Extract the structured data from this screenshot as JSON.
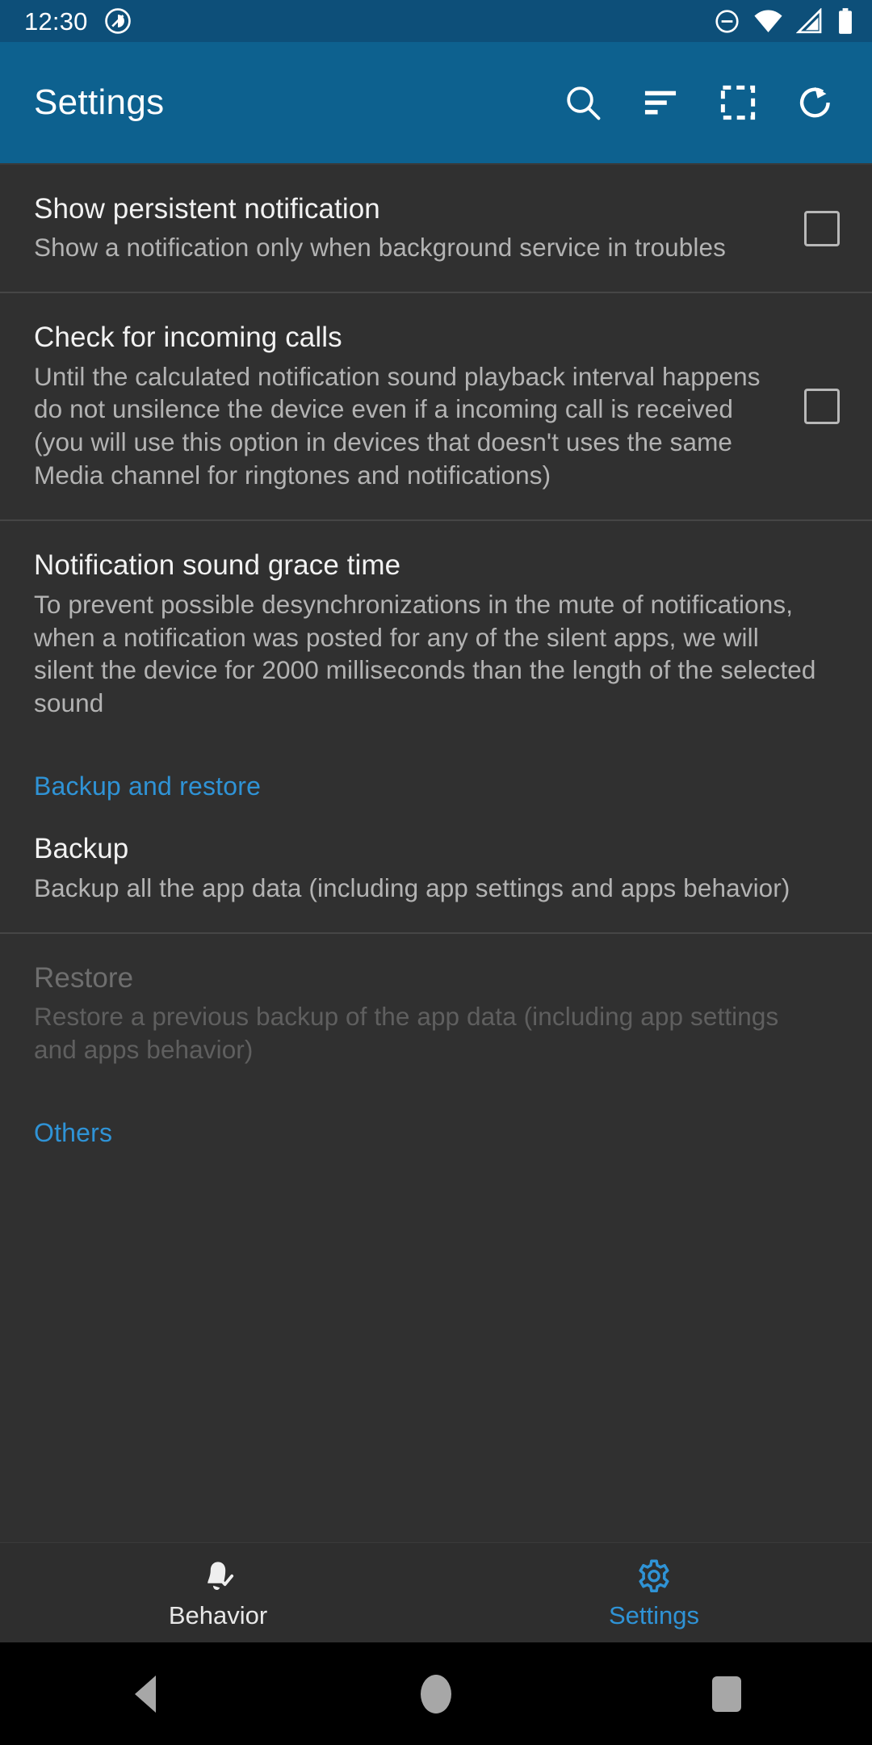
{
  "status_bar": {
    "time": "12:30",
    "icons": [
      "dnd-icon",
      "wifi-icon",
      "cellular-signal-icon",
      "battery-icon"
    ]
  },
  "app_bar": {
    "title": "Settings",
    "actions": [
      {
        "name": "search-icon",
        "label": "Search"
      },
      {
        "name": "sort-icon",
        "label": "Sort"
      },
      {
        "name": "select-all-icon",
        "label": "Select all"
      },
      {
        "name": "refresh-icon",
        "label": "Refresh"
      }
    ]
  },
  "preferences": [
    {
      "title": "Show persistent notification",
      "summary": "Show a notification only when background service in troubles",
      "widget": "checkbox",
      "checked": false,
      "enabled": true
    },
    {
      "title": "Check for incoming calls",
      "summary": "Until the calculated notification sound playback interval happens do not unsilence the device even if a incoming call is received (you will use this option in devices that doesn't uses the same Media channel for ringtones and notifications)",
      "widget": "checkbox",
      "checked": false,
      "enabled": true
    },
    {
      "title": "Notification sound grace time",
      "summary": "To prevent possible desynchronizations in the mute of notifications, when a notification was posted for any of the silent apps, we will silent the device for 2000 milliseconds than the length of the selected sound",
      "widget": "none",
      "enabled": true
    }
  ],
  "categories": {
    "backup_and_restore": "Backup and restore",
    "others": "Others"
  },
  "backup_items": [
    {
      "title": "Backup",
      "summary": "Backup all the app data (including app settings and apps behavior)",
      "enabled": true
    },
    {
      "title": "Restore",
      "summary": "Restore a previous backup of the app data (including app settings and apps behavior)",
      "enabled": false
    }
  ],
  "bottom_nav": {
    "tabs": [
      {
        "label": "Behavior",
        "icon": "bell-check-icon",
        "active": false
      },
      {
        "label": "Settings",
        "icon": "gear-icon",
        "active": true
      }
    ]
  },
  "system_nav": {
    "buttons": [
      "back-icon",
      "home-icon",
      "recents-icon"
    ]
  },
  "colors": {
    "status_bar_bg": "#0d4f79",
    "app_bar_bg": "#0d618f",
    "content_bg": "#303030",
    "accent": "#2f93d6",
    "title_text": "#f2f2f2",
    "summary_text": "#b3b3b3",
    "disabled_text": "#6e6e6e"
  }
}
